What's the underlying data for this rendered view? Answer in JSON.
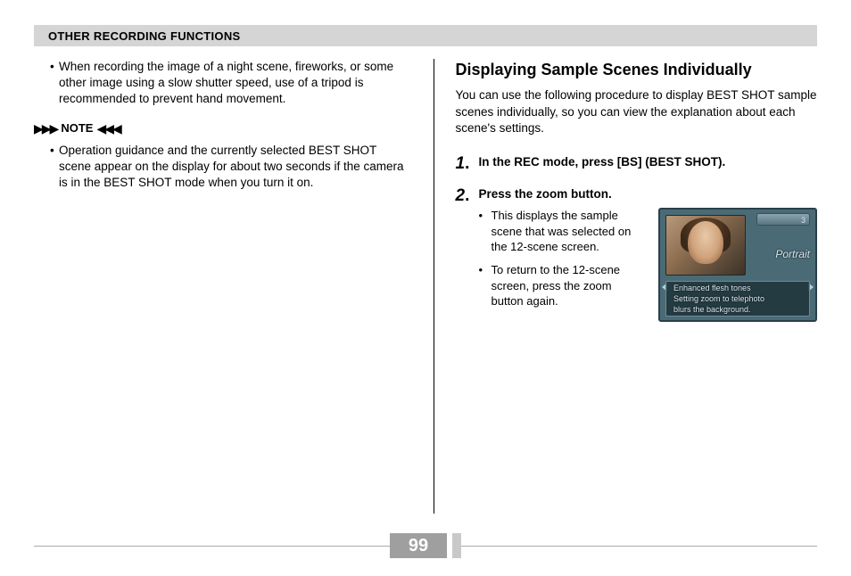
{
  "header": {
    "title": "OTHER RECORDING FUNCTIONS"
  },
  "left": {
    "bullet1": "When recording the image of a night scene, fireworks, or some other image using a slow shutter speed, use of a tripod is recommended to prevent hand movement.",
    "note_label": "NOTE",
    "note_bullet": "Operation guidance and the currently selected BEST SHOT scene appear on the display for about two seconds if the camera is in the BEST SHOT mode when you turn it on."
  },
  "right": {
    "heading": "Displaying Sample Scenes Individually",
    "intro": "You can use the following procedure to display BEST SHOT sample scenes individually, so you can view the explanation about each scene's settings.",
    "step1_num": "1",
    "step1_title": "In the REC mode, press [BS] (BEST SHOT).",
    "step2_num": "2",
    "step2_title": "Press the zoom button.",
    "step2_b1": "This displays the sample scene that was selected on the 12-scene screen.",
    "step2_b2": "To return to the 12-scene screen, press the zoom button again."
  },
  "lcd": {
    "badge": "3",
    "mode": "Portrait",
    "line1": "Enhanced flesh tones",
    "line2": "Setting zoom to telephoto",
    "line3": "blurs the background."
  },
  "footer": {
    "page": "99"
  }
}
